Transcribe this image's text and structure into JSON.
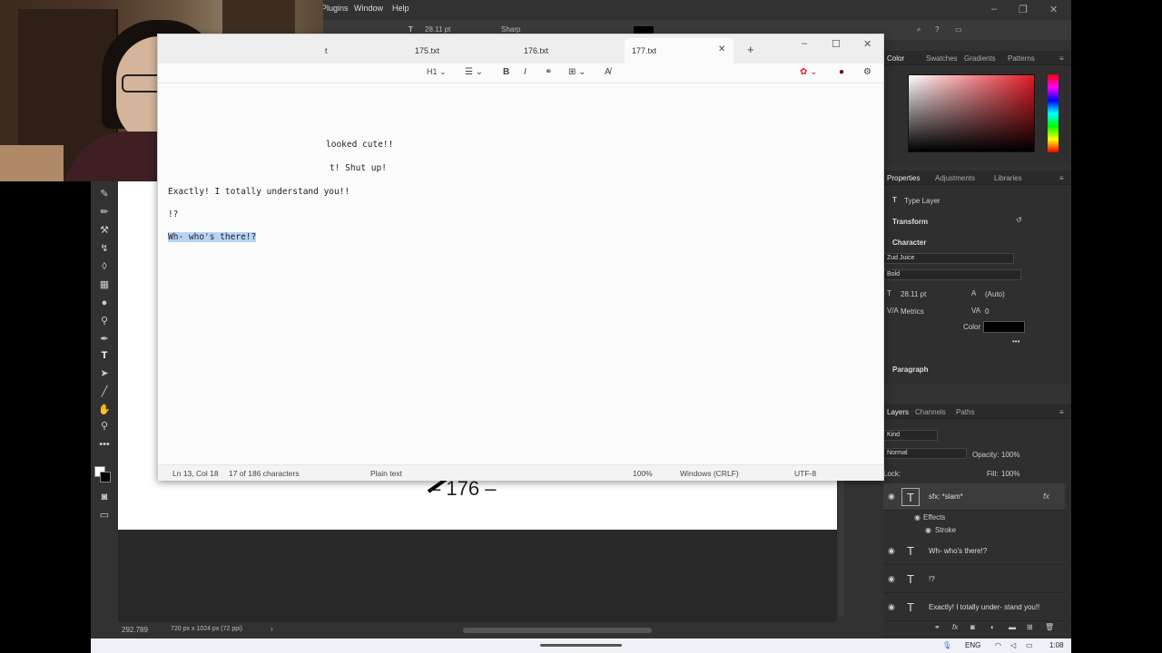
{
  "photoshop": {
    "menu": [
      "Plugins",
      "Window",
      "Help"
    ],
    "options": {
      "font_size": "28.11 pt",
      "antialias": "Sharp"
    },
    "status": {
      "zoom": "292.789",
      "doc_info": "720 px x 1024 px (72 ppi)"
    },
    "page_number": "176",
    "color_panel": {
      "tabs": [
        "Color",
        "Swatches",
        "Gradients",
        "Patterns"
      ],
      "accent": "#e01b24"
    },
    "properties_panel": {
      "tabs": [
        "Properties",
        "Adjustments",
        "Libraries"
      ],
      "layer_type": "Type Layer",
      "transform": "Transform",
      "character": "Character",
      "font_family": "Zud Juice",
      "font_style": "Bold",
      "size": "28.11 pt",
      "leading": "(Auto)",
      "kerning": "Metrics",
      "tracking": "0",
      "color_label": "Color",
      "paragraph": "Paragraph"
    },
    "layers_panel": {
      "tabs": [
        "Layers",
        "Channels",
        "Paths"
      ],
      "filter": "Kind",
      "blend_mode": "Normal",
      "opacity_label": "Opacity:",
      "opacity": "100%",
      "lock_label": "Lock:",
      "fill_label": "Fill:",
      "fill": "100%",
      "layers": [
        {
          "name": "sfx: *slam*",
          "selected": true
        },
        {
          "name": "Wh- who's there!?",
          "selected": false
        },
        {
          "name": "!?",
          "selected": false
        },
        {
          "name": "Exactly! I totally under- stand you!!",
          "selected": false
        }
      ],
      "effects_label": "Effects",
      "stroke_label": "Stroke"
    }
  },
  "notepad": {
    "tabs": [
      {
        "label": "t",
        "active": false
      },
      {
        "label": "175.txt",
        "active": false
      },
      {
        "label": "176.txt",
        "active": false
      },
      {
        "label": "177.txt",
        "active": true
      }
    ],
    "heading_label": "H1",
    "lines": [
      {
        "text": "looked cute!!",
        "selected": false
      },
      {
        "text": "t! Shut up!",
        "selected": false
      },
      {
        "text": "Exactly! I totally understand you!!",
        "selected": false
      },
      {
        "text": "!?",
        "selected": false
      },
      {
        "text": "Wh- who's there!?",
        "selected": true
      }
    ],
    "status": {
      "position": "Ln 13, Col 18",
      "chars": "17 of 186 characters",
      "format": "Plain text",
      "zoom": "100%",
      "line_ending": "Windows (CRLF)",
      "encoding": "UTF-8"
    }
  },
  "taskbar": {
    "language": "ENG",
    "time": "1:08"
  }
}
